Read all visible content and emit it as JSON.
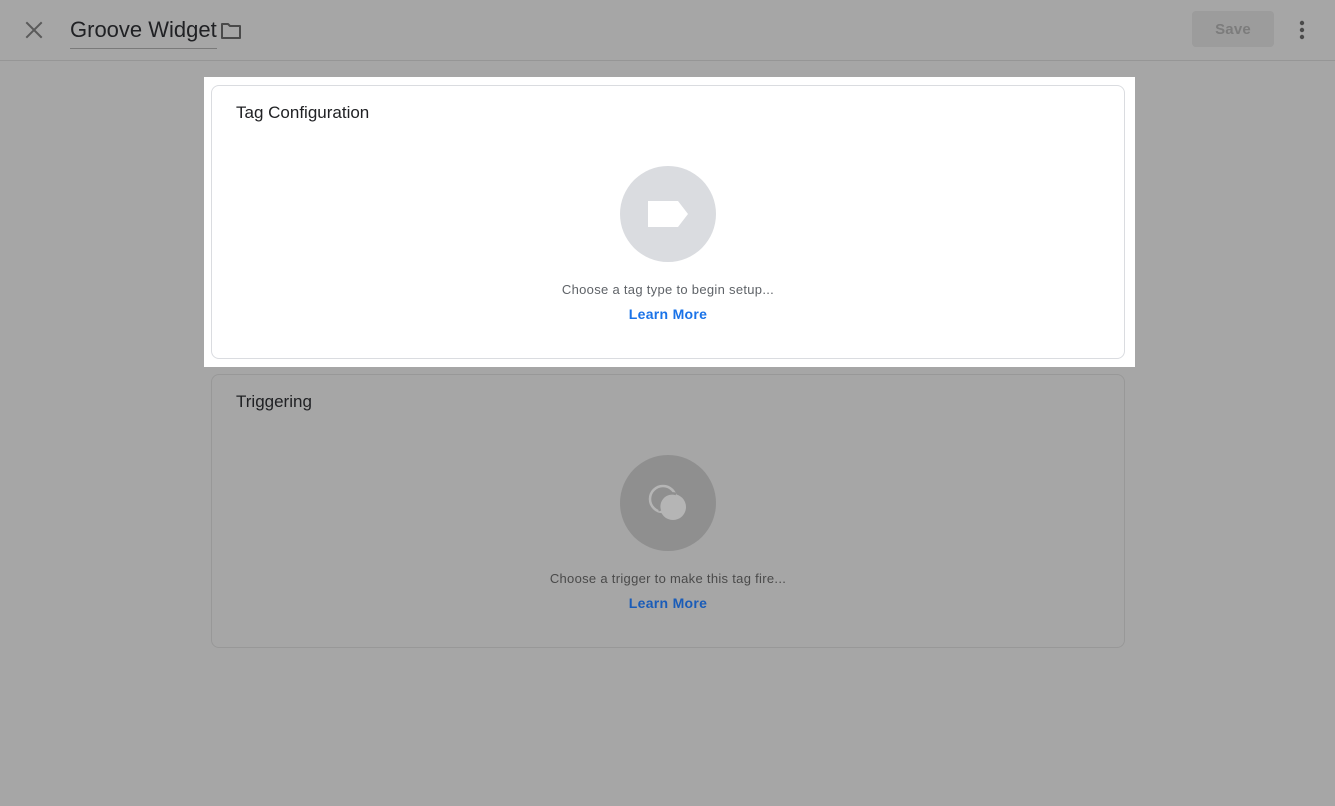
{
  "header": {
    "title": "Groove Widget",
    "save_label": "Save"
  },
  "cards": [
    {
      "title": "Tag Configuration",
      "icon": "tag-icon",
      "description": "Choose a tag type to begin setup...",
      "link": "Learn More"
    },
    {
      "title": "Triggering",
      "icon": "trigger-icon",
      "description": "Choose a trigger to make this tag fire...",
      "link": "Learn More"
    }
  ],
  "colors": {
    "accent": "#1a73e8",
    "overlay": "#a6a6a6",
    "card": "#ffffff"
  }
}
